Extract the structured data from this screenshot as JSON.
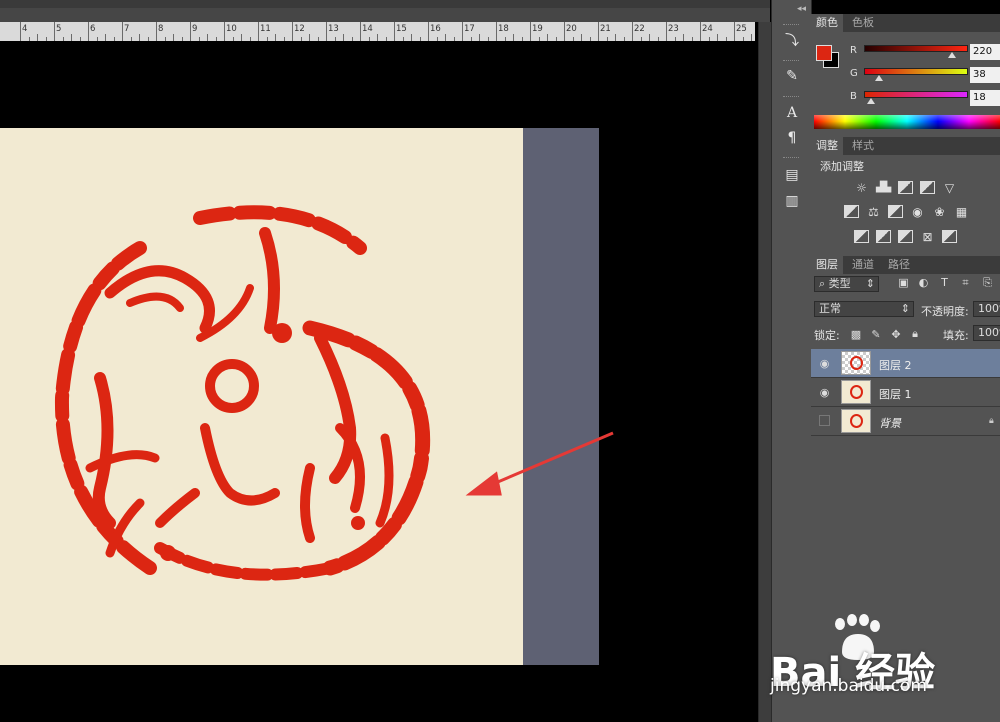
{
  "ruler": {
    "labels": [
      "4",
      "5",
      "6",
      "7",
      "8",
      "9",
      "10",
      "11",
      "12",
      "13",
      "14",
      "15",
      "16",
      "17",
      "18",
      "19",
      "20",
      "21",
      "22",
      "23",
      "24",
      "25"
    ]
  },
  "colors": {
    "foreground": "#dc2612",
    "background": "#000000",
    "selected_row": "#6d7f9c",
    "annotation_arrow": "#e53935"
  },
  "color_panel": {
    "tabs": [
      "颜色",
      "色板"
    ],
    "channels": [
      {
        "label": "R",
        "value": "220",
        "fraction": 0.86
      },
      {
        "label": "G",
        "value": "38",
        "fraction": 0.15
      },
      {
        "label": "B",
        "value": "18",
        "fraction": 0.07
      }
    ]
  },
  "adjustments_panel": {
    "tabs": [
      "调整",
      "样式"
    ],
    "title": "添加调整",
    "icons_row1": [
      "brightness-icon",
      "levels-icon",
      "curves-icon",
      "exposure-icon",
      "vibrance-icon"
    ],
    "icons_row2": [
      "hue-saturation-icon",
      "color-balance-icon",
      "black-white-icon",
      "photo-filter-icon",
      "channel-mixer-icon",
      "color-lookup-icon"
    ],
    "icons_row3": [
      "invert-icon",
      "posterize-icon",
      "threshold-icon",
      "selective-color-icon",
      "gradient-map-icon"
    ]
  },
  "layers_panel": {
    "tabs": [
      "图层",
      "通道",
      "路径"
    ],
    "filter_kind": "类型",
    "blend_mode": "正常",
    "opacity_label": "不透明度:",
    "opacity_value": "100%",
    "lock_label": "锁定:",
    "fill_label": "填充:",
    "fill_value": "100%",
    "layers": [
      {
        "name": "图层 2",
        "visible": true,
        "selected": true,
        "thumbnail": "transparent-seal"
      },
      {
        "name": "图层 1",
        "visible": true,
        "selected": false,
        "thumbnail": "seal-image"
      },
      {
        "name": "背景",
        "visible": false,
        "selected": false,
        "thumbnail": "seal-image",
        "locked": true
      }
    ]
  },
  "watermark": {
    "logo": "Bai  经验",
    "url": "jingyan.baidu.com"
  }
}
